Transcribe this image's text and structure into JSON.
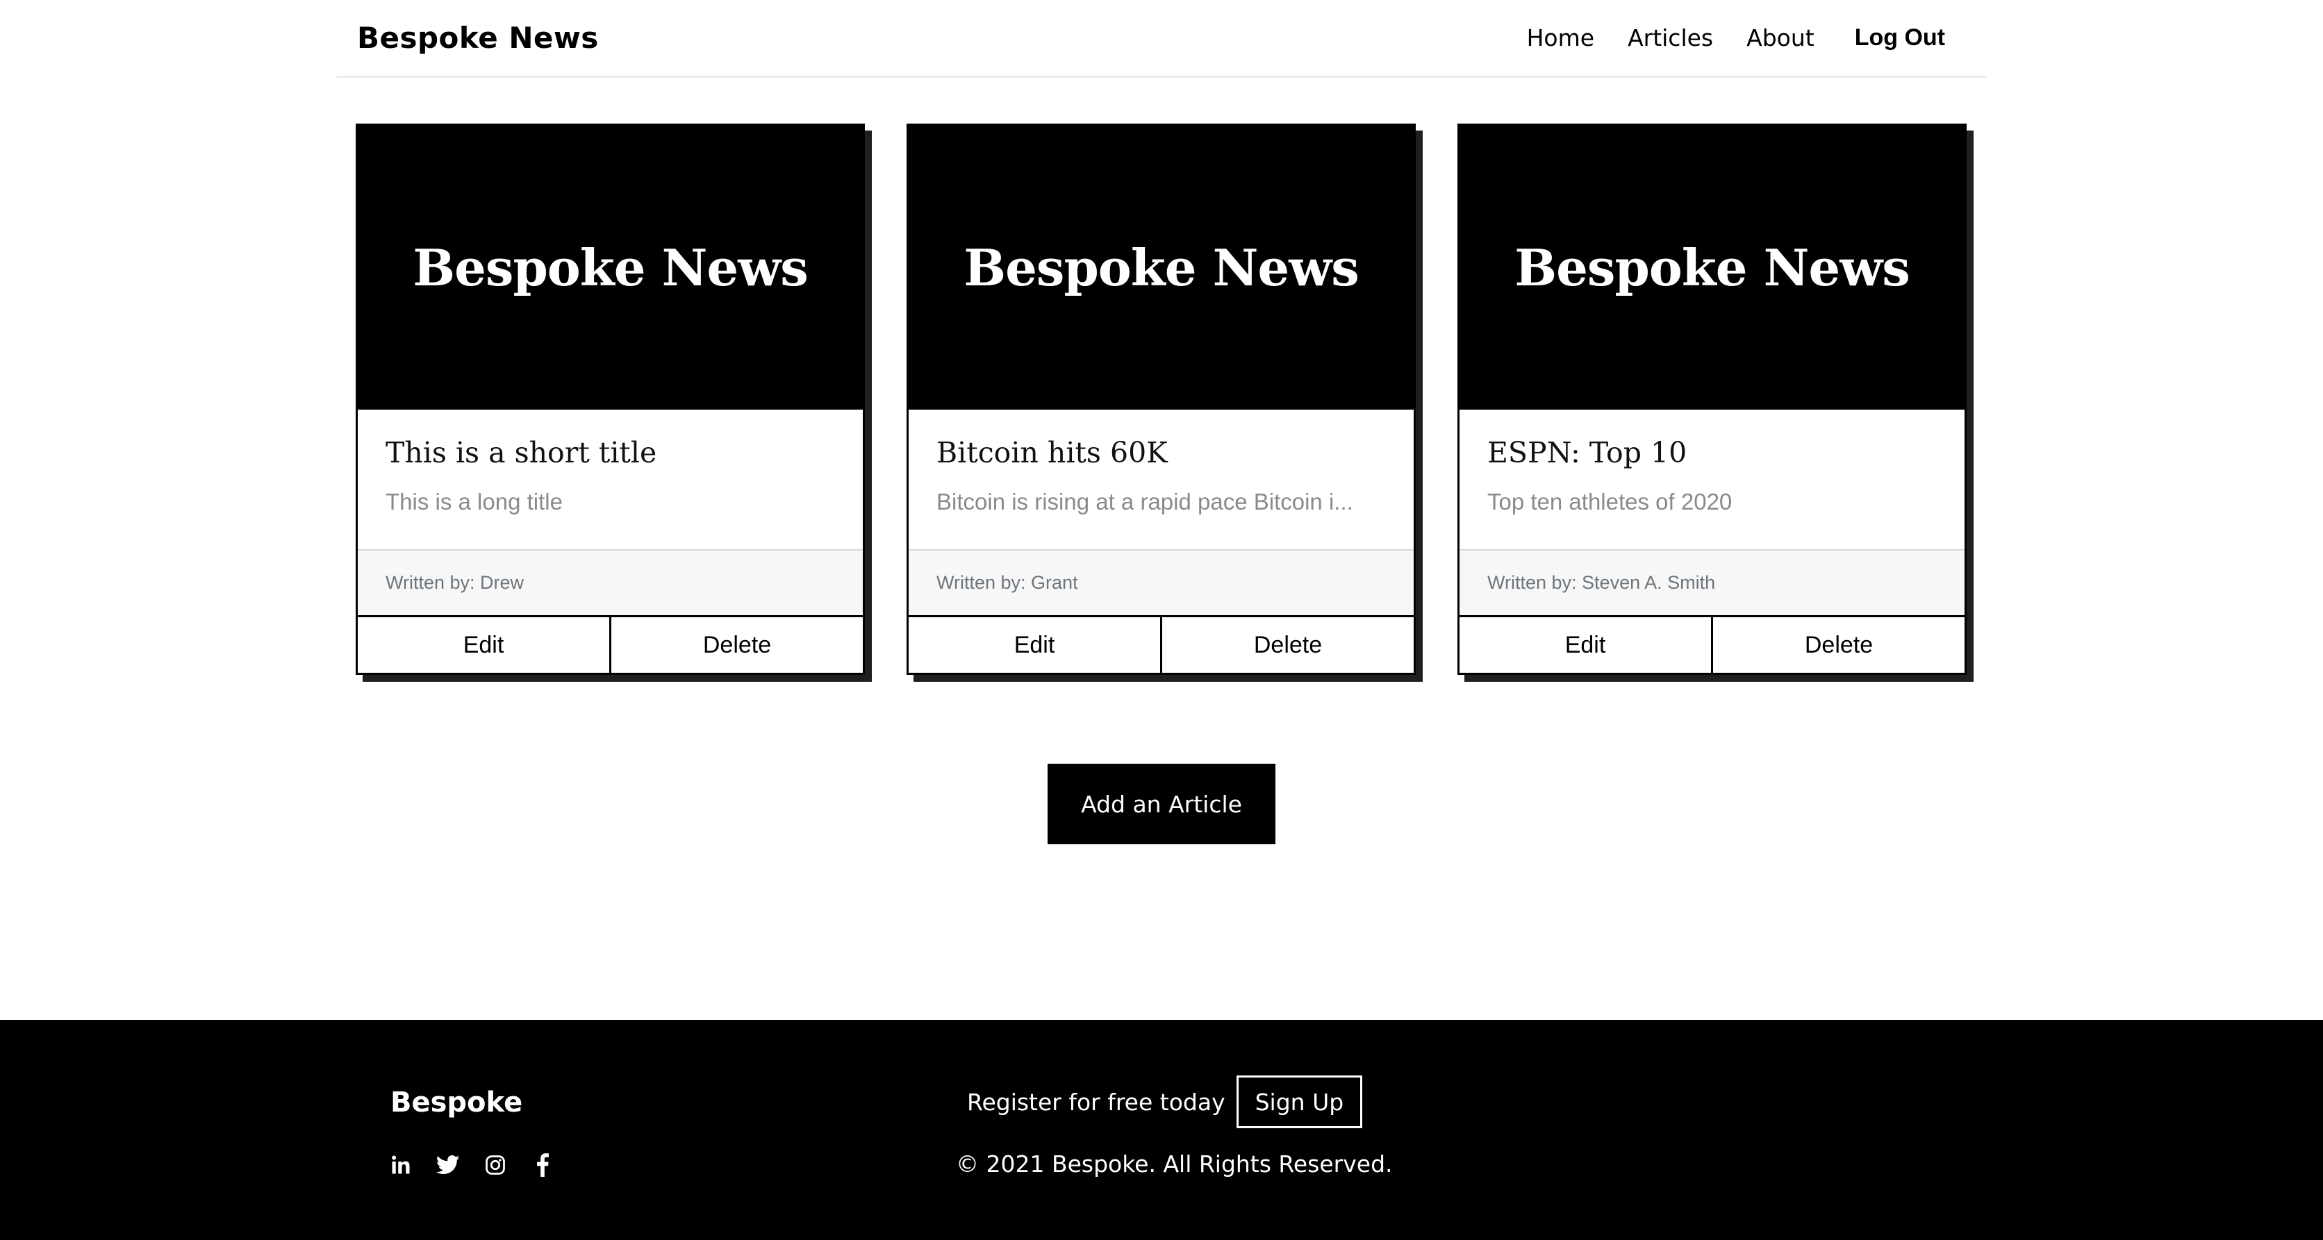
{
  "header": {
    "brand": "Bespoke News",
    "nav": [
      {
        "label": "Home"
      },
      {
        "label": "Articles"
      },
      {
        "label": "About"
      }
    ],
    "logout_label": "Log Out"
  },
  "articles": [
    {
      "banner": "Bespoke News",
      "title": "This is a short title",
      "description": "This is a long title",
      "author": "Written by: Drew",
      "edit_label": "Edit",
      "delete_label": "Delete"
    },
    {
      "banner": "Bespoke News",
      "title": "Bitcoin hits 60K",
      "description": "Bitcoin is rising at a rapid pace Bitcoin i...",
      "author": "Written by: Grant",
      "edit_label": "Edit",
      "delete_label": "Delete"
    },
    {
      "banner": "Bespoke News",
      "title": "ESPN: Top 10",
      "description": "Top ten athletes of 2020",
      "author": "Written by: Steven A. Smith",
      "edit_label": "Edit",
      "delete_label": "Delete"
    }
  ],
  "add_article_label": "Add an Article",
  "footer": {
    "brand": "Bespoke",
    "social_icons": [
      "linkedin-icon",
      "twitter-icon",
      "instagram-icon",
      "facebook-icon"
    ],
    "register_text": "Register for free today",
    "signup_label": "Sign Up",
    "copyright": "© 2021 Bespoke. All Rights Reserved."
  },
  "colors": {
    "background": "#ffffff",
    "primary": "#000000",
    "muted_text": "#8a8a8a",
    "author_text": "#6c757d",
    "card_footer_bg": "#f7f7f7"
  }
}
